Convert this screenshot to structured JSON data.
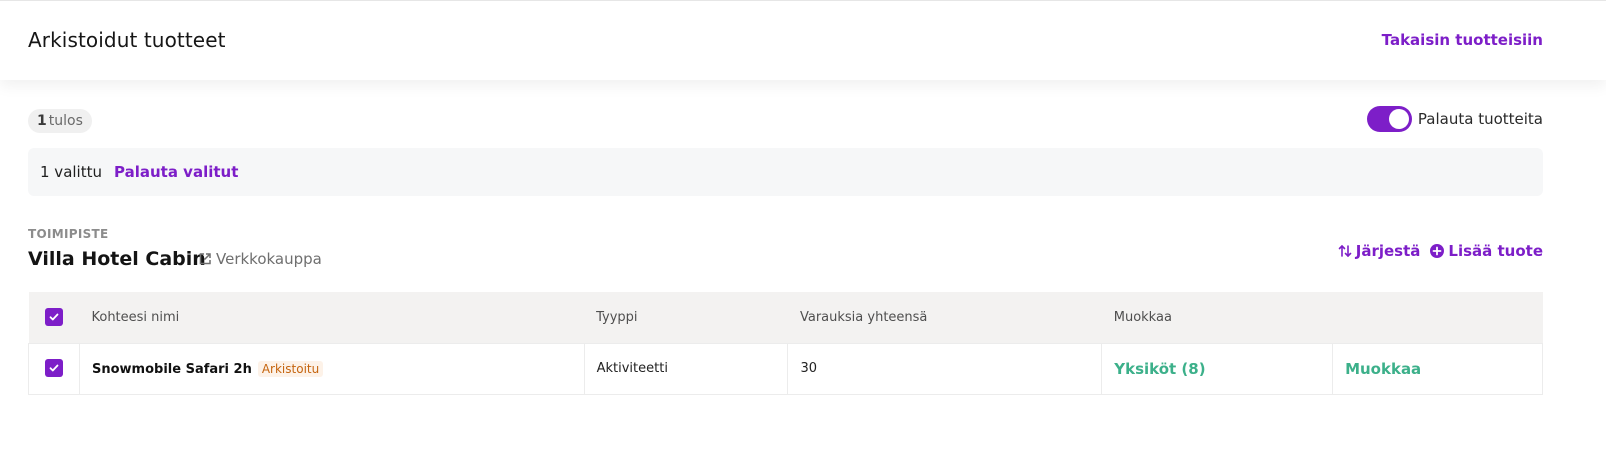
{
  "header": {
    "title": "Arkistoidut tuotteet",
    "back_link": "Takaisin tuotteisiin"
  },
  "results": {
    "count": "1",
    "suffix": "tulos"
  },
  "toggle": {
    "label": "Palauta tuotteita",
    "checked": true
  },
  "selection": {
    "count_text": "1 valittu",
    "restore_label": "Palauta valitut"
  },
  "venue": {
    "section_label": "TOIMIPISTE",
    "name": "Villa Hotel Cabin",
    "shop_link": "Verkkokauppa",
    "sort_label": "Järjestä",
    "add_label": "Lisää tuote"
  },
  "table": {
    "headers": [
      "Kohteesi nimi",
      "Tyyppi",
      "Varauksia yhteensä",
      "Muokkaa"
    ],
    "rows": [
      {
        "name": "Snowmobile Safari 2h",
        "badge": "Arkistoitu",
        "type": "Aktiviteetti",
        "bookings": "30",
        "units_link": "Yksiköt (8)",
        "edit_link": "Muokkaa",
        "checked": true
      }
    ]
  },
  "colors": {
    "accent": "#7d1ec8",
    "green": "#3cb08a",
    "badge_text": "#c5650f",
    "badge_bg": "#fdf2e8"
  },
  "icons": [
    "external-link-icon",
    "sort-icon",
    "plus-circle-icon",
    "check-icon"
  ]
}
